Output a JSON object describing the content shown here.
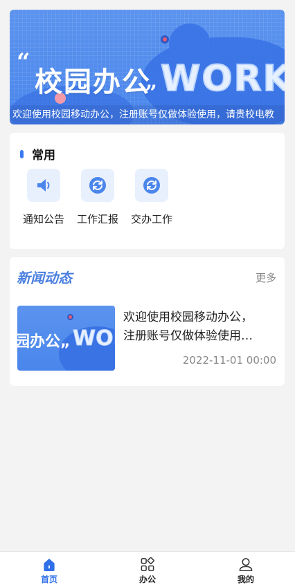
{
  "banner": {
    "title": "校园办公",
    "quote_open": "“",
    "quote_close": "„",
    "art_word": "WORK",
    "caption": "欢迎使用校园移动办公，注册账号仅做体验使用，请贵校电教"
  },
  "common": {
    "title": "常用",
    "items": [
      {
        "label": "通知公告",
        "icon": "speaker-icon"
      },
      {
        "label": "工作汇报",
        "icon": "refresh-icon"
      },
      {
        "label": "交办工作",
        "icon": "refresh-icon"
      }
    ]
  },
  "news": {
    "title": "新闻动态",
    "more": "更多",
    "items": [
      {
        "thumb_text": "园办公",
        "thumb_quote": "„",
        "thumb_word": "WOR",
        "line1": "欢迎使用校园移动办公，",
        "line2": "注册账号仅做体验使用…",
        "date": "2022-11-01 00:00"
      }
    ]
  },
  "tabbar": {
    "tabs": [
      {
        "label": "首页",
        "icon": "home-icon",
        "active": true
      },
      {
        "label": "办公",
        "icon": "apps-icon",
        "active": false
      },
      {
        "label": "我的",
        "icon": "user-icon",
        "active": false
      }
    ]
  },
  "colors": {
    "accent": "#2f6fe8",
    "banner": "#4a86ec",
    "tile_bg": "#e8f0fd",
    "page_bg": "#f3f3f4"
  }
}
